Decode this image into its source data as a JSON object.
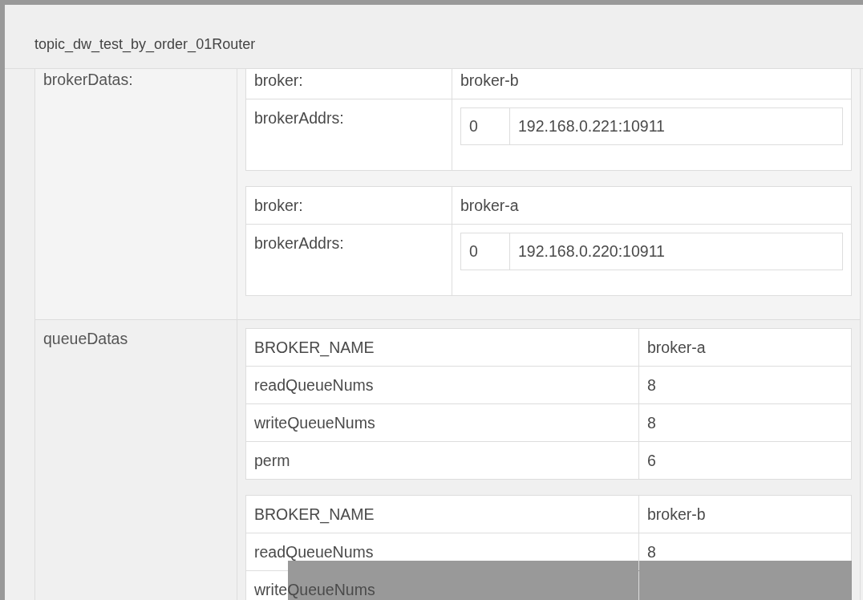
{
  "dialog": {
    "title": "topic_dw_test_by_order_01Router"
  },
  "fields": [
    {
      "label": "brokerDatas:",
      "kind": "brokers",
      "items": [
        {
          "broker_label": "broker:",
          "broker": "broker-b",
          "addrs_label": "brokerAddrs:",
          "addrs": [
            {
              "index": "0",
              "address": "192.168.0.221:10911"
            }
          ]
        },
        {
          "broker_label": "broker:",
          "broker": "broker-a",
          "addrs_label": "brokerAddrs:",
          "addrs": [
            {
              "index": "0",
              "address": "192.168.0.220:10911"
            }
          ]
        }
      ]
    },
    {
      "label": "queueDatas",
      "kind": "queues",
      "items": [
        {
          "rows": [
            {
              "key": "BROKER_NAME",
              "value": "broker-a"
            },
            {
              "key": "readQueueNums",
              "value": "8"
            },
            {
              "key": "writeQueueNums",
              "value": "8"
            },
            {
              "key": "perm",
              "value": "6"
            }
          ]
        },
        {
          "rows": [
            {
              "key": "BROKER_NAME",
              "value": "broker-b"
            },
            {
              "key": "readQueueNums",
              "value": "8"
            },
            {
              "key": "writeQueueNums"
            }
          ]
        }
      ]
    }
  ]
}
